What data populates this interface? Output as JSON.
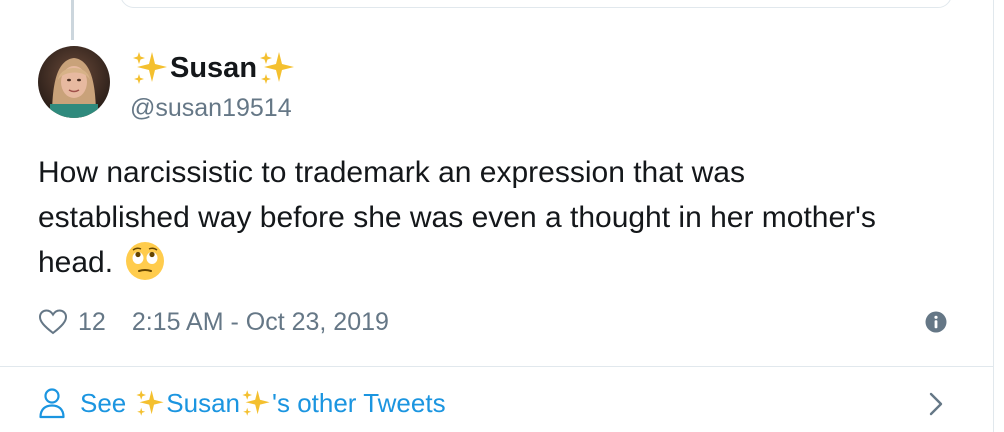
{
  "tweet": {
    "author": {
      "display_name": "Susan",
      "handle": "@susan19514",
      "name_decoration": "sparkles-emoji"
    },
    "text_lines": [
      "How narcissistic to trademark an expression that was",
      "established way before she was even a thought in her mother's",
      "head."
    ],
    "trailing_emoji": "face-with-rolling-eyes",
    "like_count": "12",
    "timestamp": "2:15 AM - Oct 23, 2019"
  },
  "footer": {
    "see_label": "See",
    "name": "Susan",
    "suffix": "'s other Tweets"
  },
  "icons": {
    "like": "heart-outline-icon",
    "info": "info-icon",
    "person": "person-outline-icon",
    "chevron": "chevron-right-icon"
  },
  "colors": {
    "link_blue": "#1b95e0",
    "secondary_text": "#657786",
    "primary_text": "#14171a",
    "border": "#e1e8ed",
    "sparkle_gold": "#f4c02f"
  }
}
